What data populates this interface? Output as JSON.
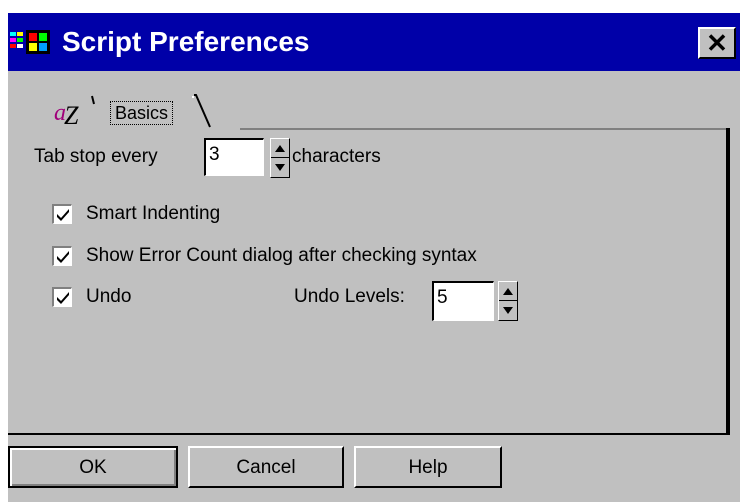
{
  "window": {
    "title": "Script Preferences",
    "close_symbol": "✕"
  },
  "tabs": [
    {
      "label": "Basics",
      "icon": "script-az-icon"
    }
  ],
  "tab_stop": {
    "label_before": "Tab stop every",
    "value": "3",
    "label_after": "characters"
  },
  "options": {
    "smart_indenting": {
      "label": "Smart Indenting",
      "checked": true
    },
    "show_error_count": {
      "label": "Show Error Count dialog after checking syntax",
      "checked": true
    },
    "undo": {
      "label": "Undo",
      "checked": true
    }
  },
  "undo_levels": {
    "label": "Undo Levels:",
    "value": "5"
  },
  "buttons": {
    "ok": "OK",
    "cancel": "Cancel",
    "help": "Help"
  },
  "colors": {
    "titlebar": "#0000a8",
    "face": "#c0c0c0"
  }
}
